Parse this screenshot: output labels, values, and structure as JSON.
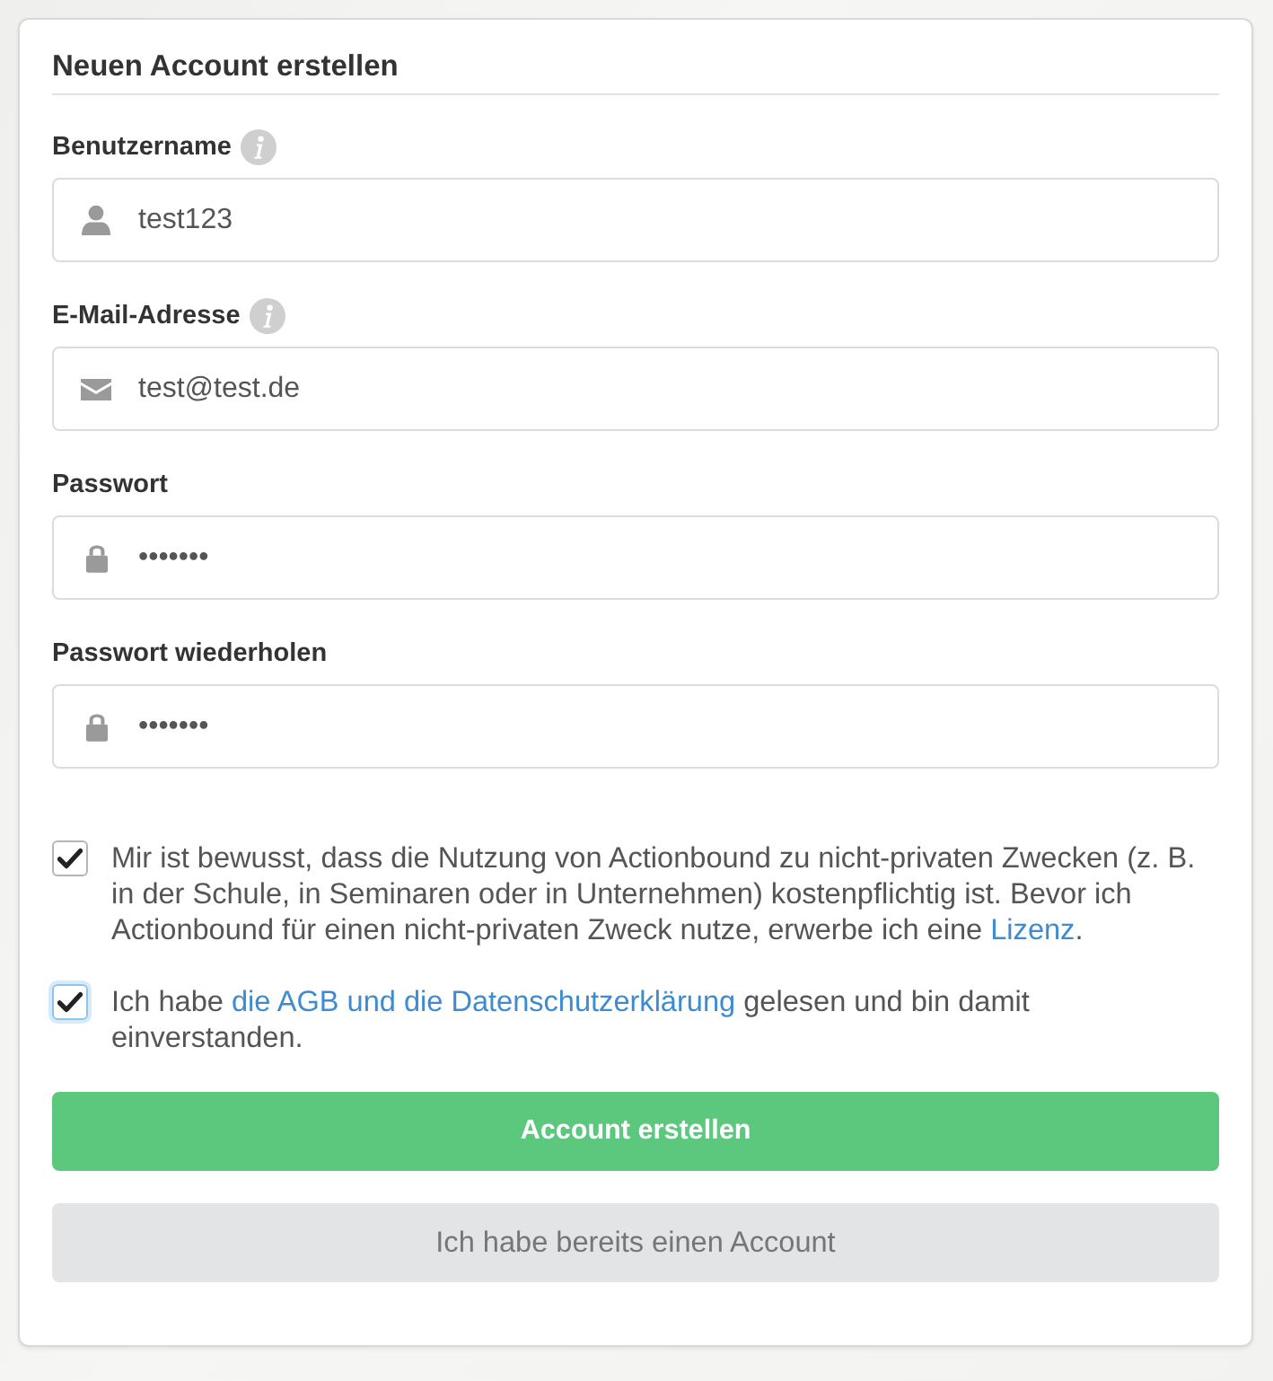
{
  "form": {
    "title": "Neuen Account erstellen"
  },
  "fields": [
    {
      "kind": "username",
      "label": "Benutzername",
      "info": true,
      "value": "test123"
    },
    {
      "kind": "email",
      "label": "E-Mail-Adresse",
      "info": true,
      "value": "test@test.de"
    },
    {
      "kind": "password",
      "label": "Passwort",
      "info": false,
      "value": "•••••••"
    },
    {
      "kind": "password",
      "label": "Passwort wiederholen",
      "info": false,
      "value": "•••••••"
    }
  ],
  "consents": [
    {
      "checked": true,
      "focused": false,
      "before": "Mir ist bewusst, dass die Nutzung von Actionbound zu nicht-privaten Zwecken (z. B. in der Schule, in Seminaren oder in Unternehmen) kostenpflichtig ist. Bevor ich Actionbound für einen nicht-privaten Zweck nutze, erwerbe ich eine ",
      "link": "Lizenz",
      "after": "."
    },
    {
      "checked": true,
      "focused": true,
      "before": "Ich habe ",
      "link": "die AGB und die Datenschutzerklärung",
      "after": " gelesen und bin damit einverstanden."
    }
  ],
  "buttons": [
    {
      "kind": "primary",
      "label": "Account erstellen"
    },
    {
      "kind": "secondary",
      "label": "Ich habe bereits einen Account"
    }
  ]
}
